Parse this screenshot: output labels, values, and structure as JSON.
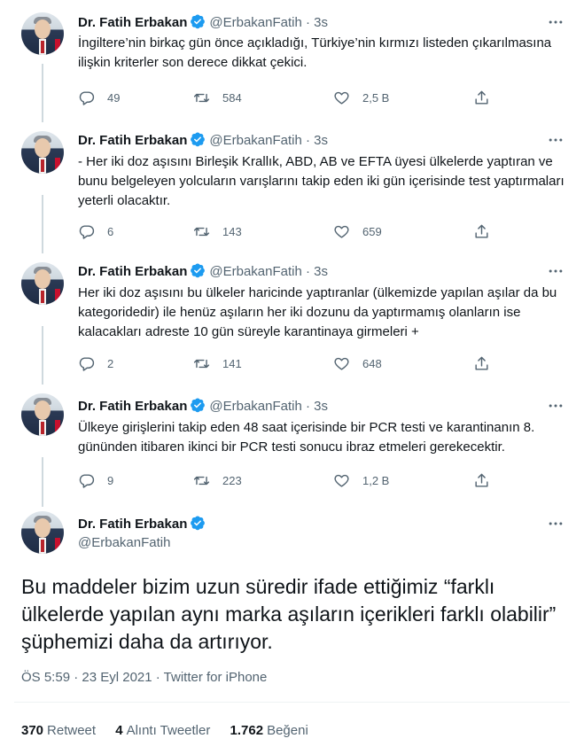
{
  "author": {
    "name": "Dr. Fatih Erbakan",
    "handle": "@ErbakanFatih",
    "dot": "·",
    "time": "3s"
  },
  "tweets": [
    {
      "text": "İngiltere’nin birkaç gün önce açıkladığı, Türkiye’nin kırmızı listeden çıkarılmasına ilişkin kriterler son derece dikkat çekici.",
      "replies": "49",
      "retweets": "584",
      "likes": "2,5 B"
    },
    {
      "text": "- Her iki doz aşısını Birleşik Krallık, ABD, AB ve EFTA üyesi ülkelerde yaptıran ve bunu belgeleyen yolcuların varışlarını takip eden iki gün içerisinde test yaptırmaları yeterli olacaktır.",
      "replies": "6",
      "retweets": "143",
      "likes": "659"
    },
    {
      "text": "Her iki doz aşısını bu ülkeler haricinde yaptıranlar (ülkemizde yapılan aşılar da bu kategoridedir) ile henüz aşıların her iki dozunu da yaptırmamış olanların ise kalacakları adreste 10 gün süreyle karantinaya girmeleri  +",
      "replies": "2",
      "retweets": "141",
      "likes": "648"
    },
    {
      "text": "Ülkeye girişlerini takip eden 48 saat içerisinde bir PCR testi ve karantinanın 8. gününden itibaren ikinci bir PCR testi sonucu ibraz etmeleri gerekecektir.",
      "replies": "9",
      "retweets": "223",
      "likes": "1,2 B"
    }
  ],
  "main_tweet": {
    "text": "Bu maddeler bizim uzun süredir ifade ettiğimiz “farklı ülkelerde yapılan aynı marka aşıların içerikleri farklı olabilir” şüphemizi daha da artırıyor.",
    "timestamp": "ÖS 5:59 · 23 Eyl 2021 · Twitter for iPhone",
    "retweets_count": "370",
    "retweets_label": "Retweet",
    "quotes_count": "4",
    "quotes_label": "Alıntı Tweetler",
    "likes_count": "1.762",
    "likes_label": "Beğeni"
  },
  "icons": [
    "verified-badge-icon",
    "more-icon",
    "reply-icon",
    "retweet-icon",
    "like-icon",
    "share-icon"
  ],
  "colors": {
    "verified": "#1d9bf0",
    "secondary_text": "#536471",
    "primary_text": "#0f1419",
    "thread_line": "#cfd9de"
  }
}
